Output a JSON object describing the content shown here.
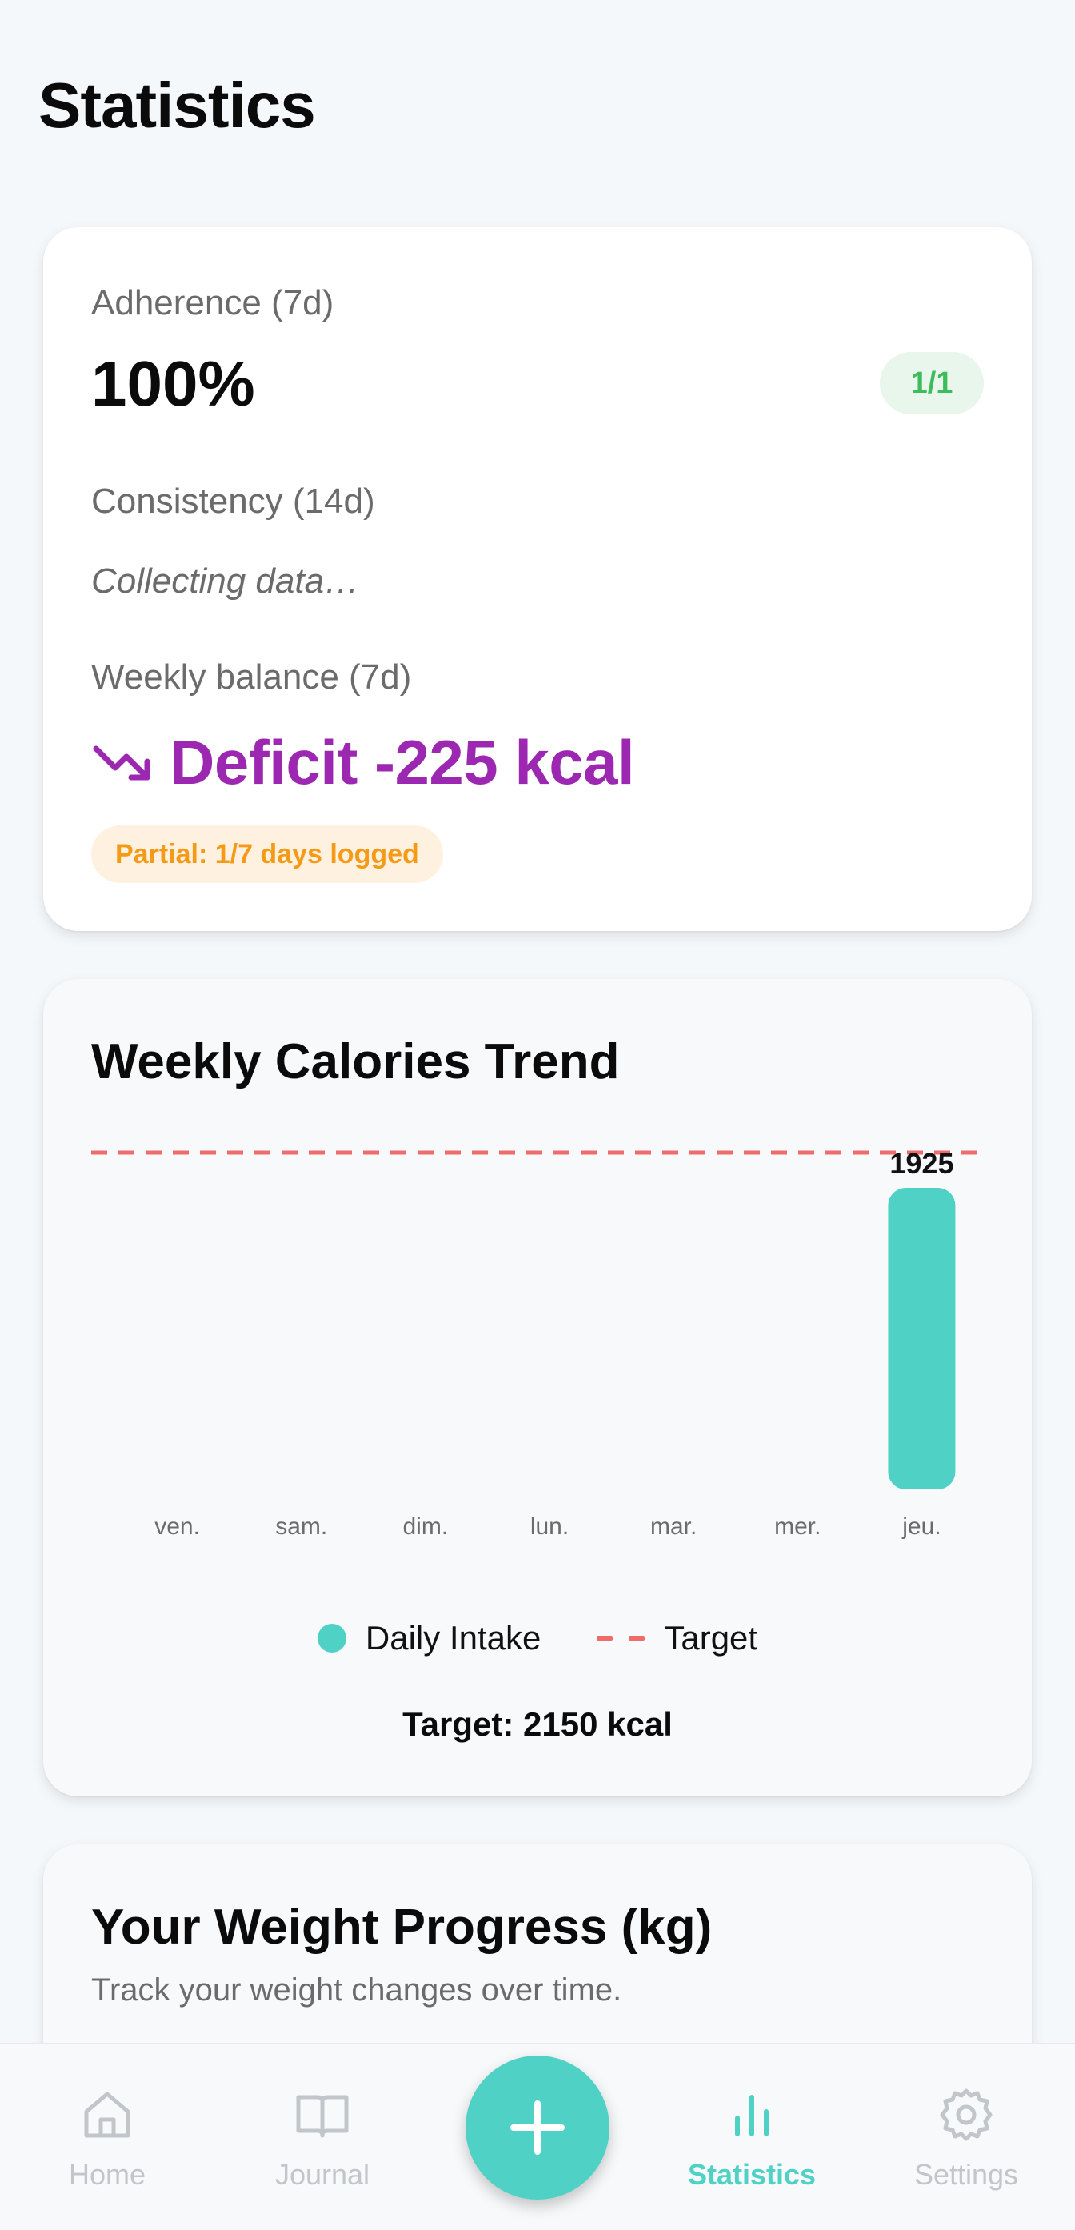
{
  "page": {
    "title": "Statistics"
  },
  "stats": {
    "adherence_label": "Adherence (7d)",
    "adherence_value": "100%",
    "adherence_badge": "1/1",
    "consistency_label": "Consistency (14d)",
    "consistency_value": "Collecting data…",
    "balance_label": "Weekly balance (7d)",
    "balance_value": "Deficit -225 kcal",
    "balance_icon": "trending-down-icon",
    "partial_badge": "Partial: 1/7 days logged"
  },
  "trend": {
    "title": "Weekly Calories Trend",
    "legend_intake": "Daily Intake",
    "legend_target": "Target",
    "target_note": "Target: 2150 kcal"
  },
  "weight": {
    "title": "Your Weight Progress (kg)",
    "subtitle": "Track your weight changes over time."
  },
  "nav": {
    "home": "Home",
    "journal": "Journal",
    "statistics": "Statistics",
    "settings": "Settings",
    "add_icon": "plus-icon"
  },
  "colors": {
    "accent": "#4fd1c5",
    "deficit": "#9c27b0",
    "target_line": "#ef6c6c",
    "badge_green": "#3cbc5a",
    "badge_orange": "#f59a16"
  },
  "chart_data": {
    "type": "bar",
    "categories": [
      "ven.",
      "sam.",
      "dim.",
      "lun.",
      "mar.",
      "mer.",
      "jeu."
    ],
    "series": [
      {
        "name": "Daily Intake",
        "values": [
          null,
          null,
          null,
          null,
          null,
          null,
          1925
        ]
      }
    ],
    "target": 2150,
    "data_labels": [
      "",
      "",
      "",
      "",
      "",
      "",
      "1925"
    ],
    "ylim": [
      0,
      2150
    ],
    "grid": false,
    "legend": "bottom-center"
  }
}
